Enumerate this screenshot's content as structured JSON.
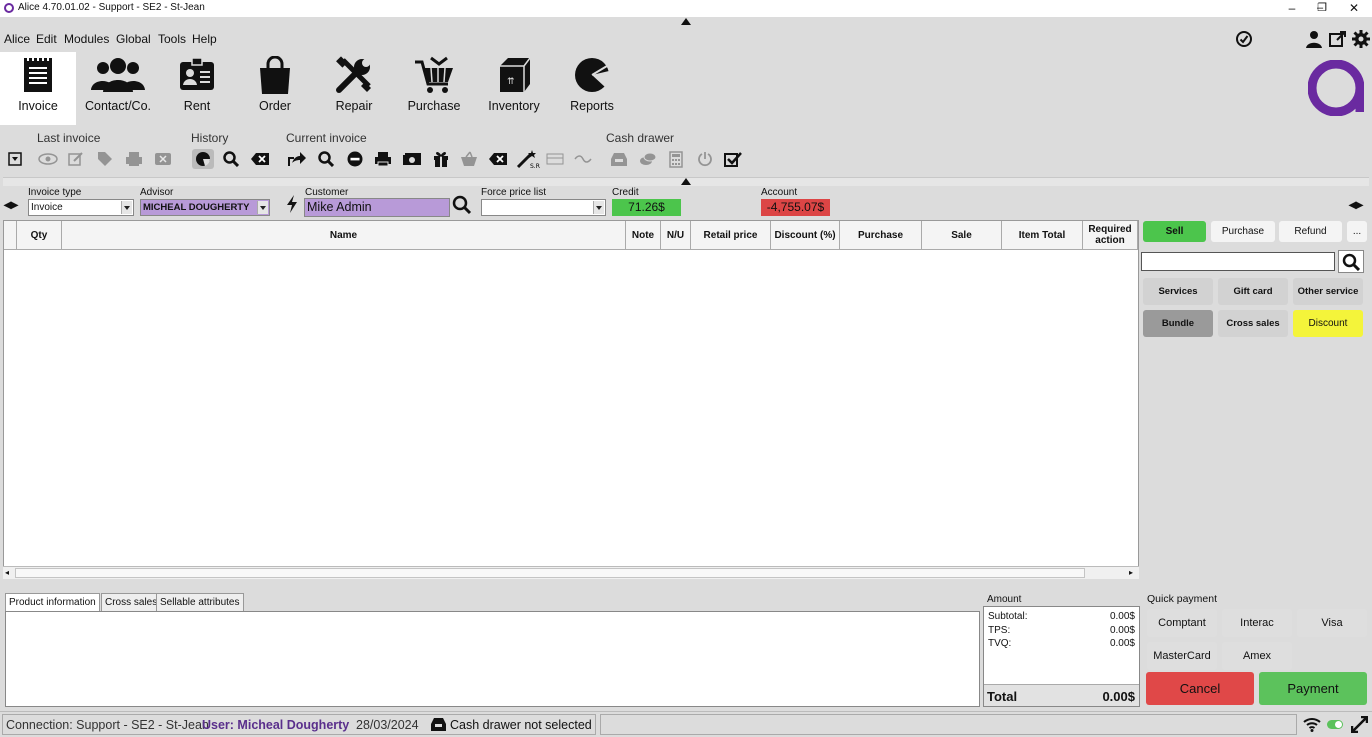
{
  "window": {
    "title": "Alice 4.70.01.02 - Support - SE2 - St-Jean",
    "minimize": "–",
    "maximize": "❐",
    "close": "✕"
  },
  "menu": [
    "Alice",
    "Edit",
    "Modules",
    "Global",
    "Tools",
    "Help"
  ],
  "modules": [
    {
      "label": "Invoice",
      "icon": "invoice-icon"
    },
    {
      "label": "Contact/Co.",
      "icon": "contacts-icon"
    },
    {
      "label": "Rent",
      "icon": "rent-icon"
    },
    {
      "label": "Order",
      "icon": "order-bag-icon"
    },
    {
      "label": "Repair",
      "icon": "repair-tools-icon"
    },
    {
      "label": "Purchase",
      "icon": "purchase-cart-icon"
    },
    {
      "label": "Inventory",
      "icon": "inventory-box-icon"
    },
    {
      "label": "Reports",
      "icon": "reports-pie-icon"
    }
  ],
  "toolbar_groups": {
    "last_invoice": "Last invoice",
    "history": "History",
    "current_invoice": "Current invoice",
    "cash_drawer": "Cash drawer"
  },
  "form": {
    "invoice_type_label": "Invoice type",
    "invoice_type_value": "Invoice",
    "advisor_label": "Advisor",
    "advisor_value": "MICHEAL DOUGHERTY",
    "customer_label": "Customer",
    "customer_value": "Mike Admin",
    "force_price_list_label": "Force price list",
    "force_price_list_value": "",
    "credit_label": "Credit",
    "credit_value": "71.26$",
    "account_label": "Account",
    "account_value": "-4,755.07$"
  },
  "columns": [
    "Qty",
    "Name",
    "Note",
    "N/U",
    "Retail price",
    "Discount (%)",
    "Purchase",
    "Sale",
    "Item Total",
    "Required action"
  ],
  "mode_buttons": {
    "sell": "Sell",
    "purchase": "Purchase",
    "refund": "Refund",
    "more": "..."
  },
  "search": {
    "placeholder": ""
  },
  "service_buttons": {
    "services": "Services",
    "gift_card": "Gift card",
    "other_service": "Other service",
    "bundle": "Bundle",
    "cross_sales": "Cross sales",
    "discount": "Discount"
  },
  "bottom_tabs": [
    "Product information",
    "Cross sales",
    "Sellable attributes"
  ],
  "amount": {
    "title": "Amount",
    "subtotal_label": "Subtotal:",
    "subtotal": "0.00$",
    "tps_label": "TPS:",
    "tps": "0.00$",
    "tvq_label": "TVQ:",
    "tvq": "0.00$",
    "total_label": "Total",
    "total": "0.00$"
  },
  "quick_payment": {
    "title": "Quick payment",
    "methods": [
      "Comptant",
      "Interac",
      "Visa",
      "MasterCard",
      "Amex"
    ],
    "cancel": "Cancel",
    "payment": "Payment"
  },
  "status": {
    "connection": "Connection: Support - SE2 - St-Jean",
    "user": "User: Micheal Dougherty",
    "date": "28/03/2024",
    "cash_drawer": "Cash drawer not selected"
  },
  "colors": {
    "brand": "#6a2aa0",
    "sell": "#4cc54c",
    "credit": "#4cc54c",
    "account": "#dc4545",
    "discount": "#f4f43a",
    "cancel": "#e04848",
    "payment": "#5cc25c"
  }
}
